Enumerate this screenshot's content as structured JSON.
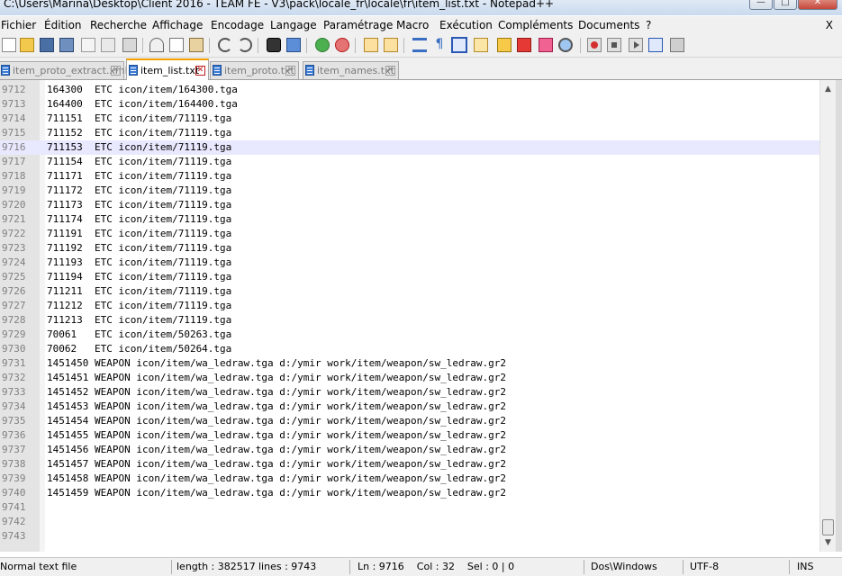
{
  "window": {
    "title": "C:\\Users\\Marina\\Desktop\\Client 2016 - TEAM FE - V3\\pack\\locale_fr\\locale\\fr\\item_list.txt - Notepad++"
  },
  "menu": {
    "items": [
      "Fichier",
      "Édition",
      "Recherche",
      "Affichage",
      "Encodage",
      "Langage",
      "Paramétrage",
      "Macro",
      "Exécution",
      "Compléments",
      "Documents",
      "?"
    ],
    "close_label": "X"
  },
  "toolbar": {
    "icons": [
      "new-file-icon",
      "open-file-icon",
      "save-icon",
      "save-all-icon",
      "close-icon",
      "close-all-icon",
      "print-icon",
      "cut-icon",
      "copy-icon",
      "paste-icon",
      "undo-icon",
      "redo-icon",
      "find-icon",
      "replace-icon",
      "zoom-in-icon",
      "zoom-out-icon",
      "sync-vertical-icon",
      "sync-horizontal-icon",
      "word-wrap-icon",
      "show-all-chars-icon",
      "indent-guide-icon",
      "doc-map-icon",
      "function-list-icon",
      "folder-workspace-icon",
      "monitoring-icon",
      "record-macro-icon",
      "stop-record-icon",
      "play-macro-icon",
      "run-multiple-icon",
      "save-macro-icon"
    ]
  },
  "tabs": [
    {
      "label": "item_proto_extract.xml",
      "active": false
    },
    {
      "label": "item_list.txt",
      "active": true
    },
    {
      "label": "item_proto.txt",
      "active": false
    },
    {
      "label": "item_names.txt",
      "active": false
    }
  ],
  "editor": {
    "current_line": 9716,
    "lines": [
      {
        "n": "9712",
        "text": "164300  ETC icon/item/164300.tga"
      },
      {
        "n": "9713",
        "text": "164400  ETC icon/item/164400.tga"
      },
      {
        "n": "9714",
        "text": "711151  ETC icon/item/71119.tga"
      },
      {
        "n": "9715",
        "text": "711152  ETC icon/item/71119.tga"
      },
      {
        "n": "9716",
        "text": "711153  ETC icon/item/71119.tga"
      },
      {
        "n": "9717",
        "text": "711154  ETC icon/item/71119.tga"
      },
      {
        "n": "9718",
        "text": "711171  ETC icon/item/71119.tga"
      },
      {
        "n": "9719",
        "text": "711172  ETC icon/item/71119.tga"
      },
      {
        "n": "9720",
        "text": "711173  ETC icon/item/71119.tga"
      },
      {
        "n": "9721",
        "text": "711174  ETC icon/item/71119.tga"
      },
      {
        "n": "9722",
        "text": "711191  ETC icon/item/71119.tga"
      },
      {
        "n": "9723",
        "text": "711192  ETC icon/item/71119.tga"
      },
      {
        "n": "9724",
        "text": "711193  ETC icon/item/71119.tga"
      },
      {
        "n": "9725",
        "text": "711194  ETC icon/item/71119.tga"
      },
      {
        "n": "9726",
        "text": "711211  ETC icon/item/71119.tga"
      },
      {
        "n": "9727",
        "text": "711212  ETC icon/item/71119.tga"
      },
      {
        "n": "9728",
        "text": "711213  ETC icon/item/71119.tga"
      },
      {
        "n": "9729",
        "text": "70061   ETC icon/item/50263.tga"
      },
      {
        "n": "9730",
        "text": "70062   ETC icon/item/50264.tga"
      },
      {
        "n": "9731",
        "text": "1451450 WEAPON icon/item/wa_ledraw.tga d:/ymir work/item/weapon/sw_ledraw.gr2"
      },
      {
        "n": "9732",
        "text": "1451451 WEAPON icon/item/wa_ledraw.tga d:/ymir work/item/weapon/sw_ledraw.gr2"
      },
      {
        "n": "9733",
        "text": "1451452 WEAPON icon/item/wa_ledraw.tga d:/ymir work/item/weapon/sw_ledraw.gr2"
      },
      {
        "n": "9734",
        "text": "1451453 WEAPON icon/item/wa_ledraw.tga d:/ymir work/item/weapon/sw_ledraw.gr2"
      },
      {
        "n": "9735",
        "text": "1451454 WEAPON icon/item/wa_ledraw.tga d:/ymir work/item/weapon/sw_ledraw.gr2"
      },
      {
        "n": "9736",
        "text": "1451455 WEAPON icon/item/wa_ledraw.tga d:/ymir work/item/weapon/sw_ledraw.gr2"
      },
      {
        "n": "9737",
        "text": "1451456 WEAPON icon/item/wa_ledraw.tga d:/ymir work/item/weapon/sw_ledraw.gr2"
      },
      {
        "n": "9738",
        "text": "1451457 WEAPON icon/item/wa_ledraw.tga d:/ymir work/item/weapon/sw_ledraw.gr2"
      },
      {
        "n": "9739",
        "text": "1451458 WEAPON icon/item/wa_ledraw.tga d:/ymir work/item/weapon/sw_ledraw.gr2"
      },
      {
        "n": "9740",
        "text": "1451459 WEAPON icon/item/wa_ledraw.tga d:/ymir work/item/weapon/sw_ledraw.gr2"
      },
      {
        "n": "9741",
        "text": ""
      },
      {
        "n": "9742",
        "text": ""
      },
      {
        "n": "9743",
        "text": ""
      }
    ]
  },
  "scrollbar": {
    "up_arrow": "▲",
    "down_arrow": "▼"
  },
  "statusbar": {
    "file_type": "Normal text file",
    "length": "length : 382517",
    "lines": "lines : 9743",
    "position": "Ln : 9716    Col : 32    Sel : 0 | 0",
    "eol": "Dos\\Windows",
    "encoding": "UTF-8",
    "mode": "INS"
  }
}
